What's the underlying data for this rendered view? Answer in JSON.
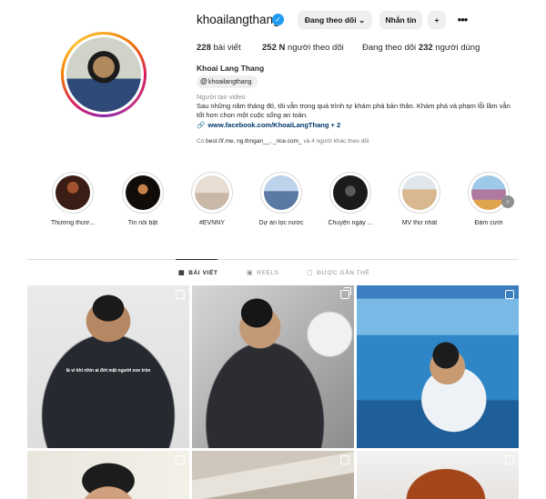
{
  "profile": {
    "username": "khoailangthang",
    "follow_button": "Đang theo dõi",
    "message_button": "Nhắn tin",
    "posts_count": "228",
    "posts_label": "bài viết",
    "followers_count": "252 N",
    "followers_label": "người theo dõi",
    "following_prefix": "Đang theo dõi",
    "following_count": "232",
    "following_label": "người dùng",
    "full_name": "Khoai Lang Thang",
    "threads_handle": "khoailangthang",
    "category": "Người tạo video",
    "bio": "Sau những năm tháng đó, tôi vẫn trong quá trình tự khám phá bản thân. Khám phá và phạm lỗi lầm vẫn tốt hơn chọn một cuộc sống an toàn.",
    "link": "www.facebook.com/KhoaiLangThang + 2",
    "followed_by_prefix": "Có",
    "followed_by_names": "best.0f.me, ng.thngan__, _rice.com_",
    "followed_by_suffix": "và 4 người khác theo dõi"
  },
  "highlights": [
    {
      "label": "Thương thươ...",
      "color": "#3a1d14"
    },
    {
      "label": "Tin nổi bật",
      "color": "#120c08"
    },
    {
      "label": "#EVNNY",
      "color": "#c9b8a8"
    },
    {
      "label": "Dự án lọc nước",
      "color": "#5b7aa3"
    },
    {
      "label": "Chuyện ngày ...",
      "color": "#1b1b1b"
    },
    {
      "label": "MV thứ nhất",
      "color": "#d9b78f"
    },
    {
      "label": "Đám cưới",
      "color": "#b07aa0"
    }
  ],
  "tabs": {
    "posts": "BÀI VIẾT",
    "reels": "REELS",
    "tagged": "ĐƯỢC GẮN THẺ"
  },
  "grid": {
    "post1_overlay": "là vì khi nhìn ai đời mặt người xoe tròn"
  },
  "icons": {
    "verified": "verified-badge-icon",
    "add_user": "add-user-icon",
    "more": "more-options-icon",
    "threads": "threads-icon",
    "link": "link-chain-icon"
  }
}
